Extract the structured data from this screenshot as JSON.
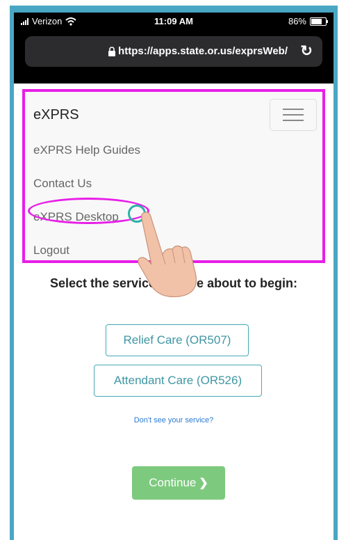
{
  "status_bar": {
    "carrier": "Verizon",
    "time": "11:09 AM",
    "battery": "86%",
    "battery_level": 0.86
  },
  "browser": {
    "url": "https://apps.state.or.us/exprsWeb/"
  },
  "navbar": {
    "brand": "eXPRS",
    "items": [
      {
        "label": "eXPRS Help Guides"
      },
      {
        "label": "Contact Us"
      },
      {
        "label": "eXPRS Desktop"
      },
      {
        "label": "Logout"
      }
    ]
  },
  "main": {
    "heading": "Select the service you are about to begin:",
    "services": [
      {
        "label": "Relief Care (OR507)"
      },
      {
        "label": "Attendant Care (OR526)"
      }
    ],
    "help_link": "Don't see your service?",
    "continue_label": "Continue"
  },
  "colors": {
    "highlight": "#e81ee8",
    "frame": "#4aa7c4",
    "button_text": "#3f96a3",
    "continue_bg": "#7dca7e",
    "link": "#2a7bd1"
  }
}
